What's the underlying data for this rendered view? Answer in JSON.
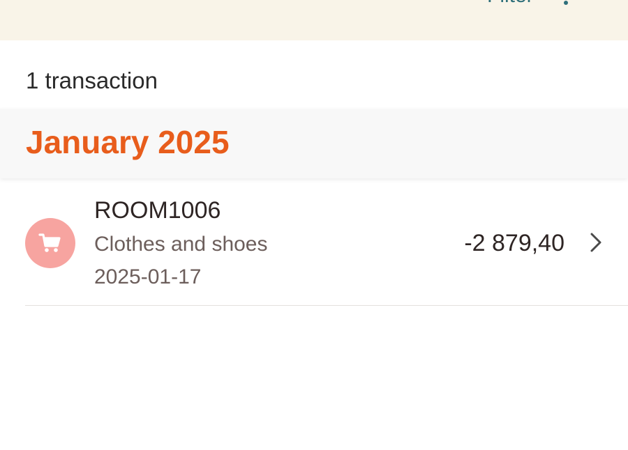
{
  "header": {
    "filter_label": "Filter",
    "filter_icon": "filter-icon",
    "background": "#f9f4e8",
    "accent": "#2f6f7a"
  },
  "summary": {
    "count_text": "1 transaction"
  },
  "groups": [
    {
      "month": "January 2025",
      "month_color": "#e85d1c",
      "transactions": [
        {
          "name": "ROOM1006",
          "category": "Clothes and shoes",
          "date": "2025-01-17",
          "amount": "-2 879,40",
          "icon": "shopping-cart-icon",
          "icon_bg": "#f7a4a0",
          "chevron_icon": "chevron-right-icon"
        }
      ]
    }
  ]
}
